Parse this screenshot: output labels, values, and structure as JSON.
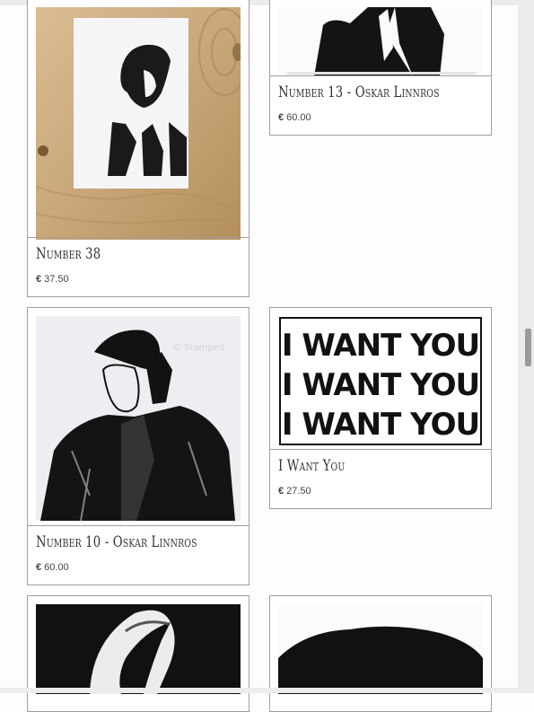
{
  "products": [
    {
      "title": "Number 38",
      "currency": "€",
      "price": "37.50"
    },
    {
      "title": "Number 13 - Oskar Linnros",
      "currency": "€",
      "price": "60.00"
    },
    {
      "title": "Number 10 - Oskar Linnros",
      "currency": "€",
      "price": "60.00"
    },
    {
      "title": "I Want You",
      "currency": "€",
      "price": "27.50"
    }
  ],
  "artwork": {
    "i_want_you_lines": [
      "I WANT YOU",
      "I WANT YOU",
      "I WANT YOU"
    ],
    "watermark": "© Stamped"
  },
  "colors": {
    "ink": "#111111",
    "wood": "#c9a779",
    "border": "#9f9f9f"
  }
}
